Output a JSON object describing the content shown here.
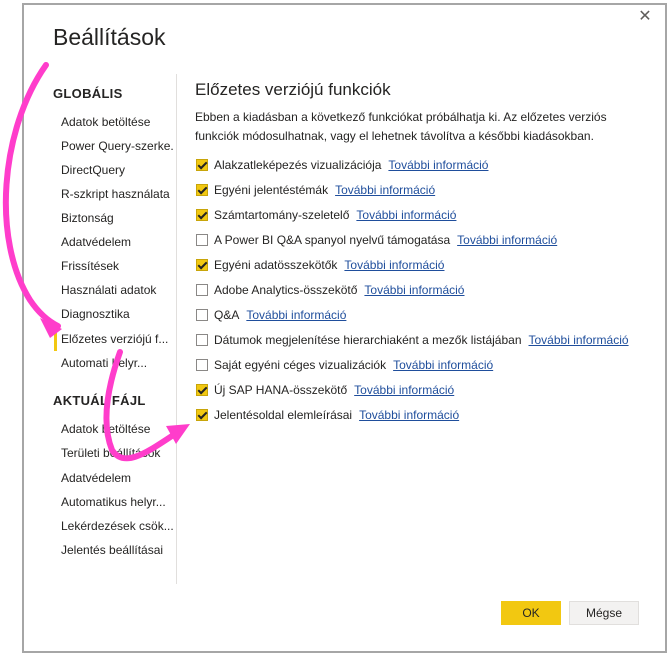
{
  "dialog": {
    "title": "Beállítások",
    "close_glyph": "✕"
  },
  "sidebar": {
    "global_header": "GLOBÁLIS",
    "global_items": [
      {
        "label": "Adatok betöltése"
      },
      {
        "label": "Power Query-szerke..."
      },
      {
        "label": "DirectQuery"
      },
      {
        "label": "R-szkript használata"
      },
      {
        "label": "Biztonság"
      },
      {
        "label": "Adatvédelem"
      },
      {
        "label": "Frissítések"
      },
      {
        "label": "Használati adatok"
      },
      {
        "label": "Diagnosztika"
      },
      {
        "label": "Előzetes verziójú f..."
      },
      {
        "label": "Automati    helyr..."
      }
    ],
    "file_header": "AKTUÁL    FÁJL",
    "file_items": [
      {
        "label": "Adatok betöltése"
      },
      {
        "label": "Területi beállítások"
      },
      {
        "label": "Adatvédelem"
      },
      {
        "label": "Automatikus helyr..."
      },
      {
        "label": "Lekérdezések csök..."
      },
      {
        "label": "Jelentés beállításai"
      }
    ],
    "active_item": "Előzetes verziójú f...",
    "active_color": "#f2c811"
  },
  "main": {
    "title": "Előzetes verziójú funkciók",
    "description": "Ebben a kiadásban a következő funkciókat próbálhatja ki. Az előzetes verziós funkciók módosulhatnak, vagy el lehetnek távolítva a későbbi kiadásokban.",
    "more_info_label": "További információ",
    "features": [
      {
        "label": "Alakzatleképezés vizualizációja",
        "checked": true
      },
      {
        "label": "Egyéni jelentéstémák",
        "checked": true
      },
      {
        "label": "Számtartomány-szeletelő",
        "checked": true
      },
      {
        "label": "A Power BI Q&A spanyol nyelvű támogatása",
        "checked": false
      },
      {
        "label": "Egyéni adatösszekötők",
        "checked": true
      },
      {
        "label": "Adobe Analytics-összekötő",
        "checked": false
      },
      {
        "label": "Q&A",
        "checked": false
      },
      {
        "label": "Dátumok megjelenítése hierarchiaként a mezők listájában",
        "checked": false
      },
      {
        "label": "Saját egyéni céges vizualizációk",
        "checked": false
      },
      {
        "label": "Új SAP HANA-összekötő",
        "checked": true
      },
      {
        "label": "Jelentésoldal elemleírásai",
        "checked": true
      }
    ]
  },
  "buttons": {
    "ok": "OK",
    "cancel": "Mégse"
  },
  "colors": {
    "accent": "#f2c811",
    "link": "#1f4e9c",
    "annotation_arrow": "#ff3dcb"
  }
}
